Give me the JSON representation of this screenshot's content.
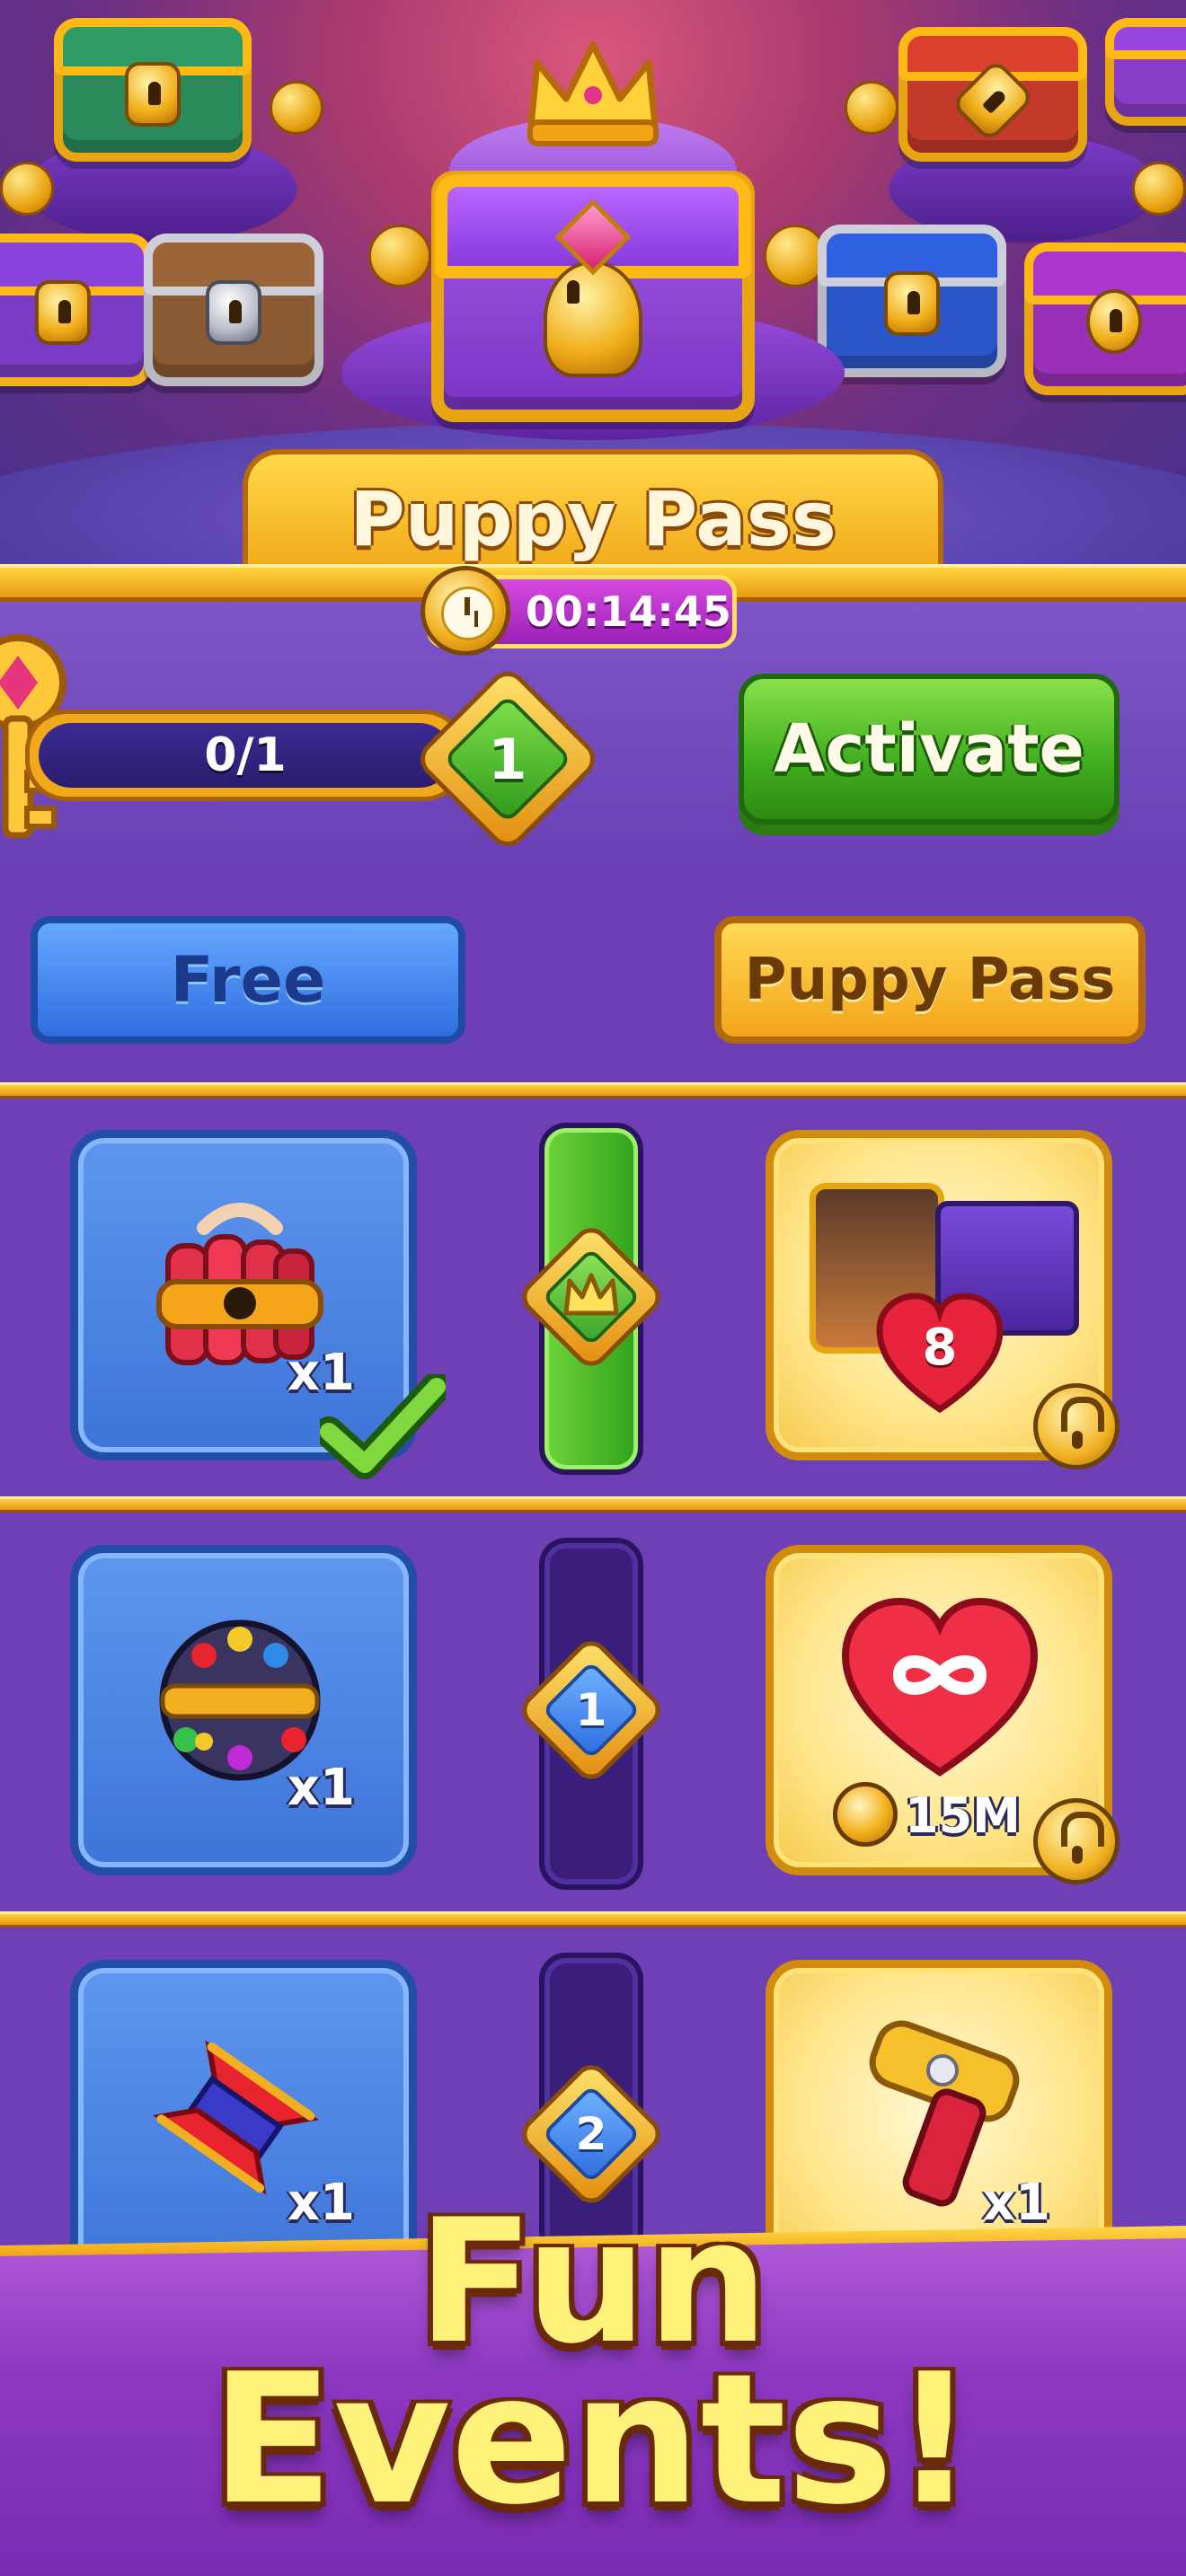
{
  "header": {
    "title": "Puppy Pass",
    "timer": "00:14:45"
  },
  "progress": {
    "value_text": "0/1",
    "level": "1",
    "activate_label": "Activate"
  },
  "tabs": {
    "free_label": "Free",
    "pass_label": "Puppy Pass"
  },
  "rows": [
    {
      "step": "crown",
      "free_qty": "x1",
      "free_item": "dynamite-bundle",
      "free_claimed": true,
      "pass_item": "character-gift",
      "pass_badge": "8",
      "pass_locked": true,
      "track_filled": true
    },
    {
      "step": "1",
      "free_qty": "x1",
      "free_item": "gem-disco-ball",
      "pass_item": "infinite-heart",
      "pass_qty": "15M",
      "pass_locked": true,
      "track_filled": false
    },
    {
      "step": "2",
      "free_qty": "x1",
      "free_item": "spinner-top",
      "pass_item": "golden-hammer",
      "pass_qty": "x1",
      "pass_locked": true,
      "track_filled": false
    }
  ],
  "footer": {
    "line1": "Fun",
    "line2": "Events!"
  },
  "colors": {
    "accent_gold": "#f0a414",
    "free_blue": "#3f74d8",
    "activate_green": "#3fae1e",
    "timer_magenta": "#9b1fb8",
    "background_purple": "#6e3fb5"
  }
}
